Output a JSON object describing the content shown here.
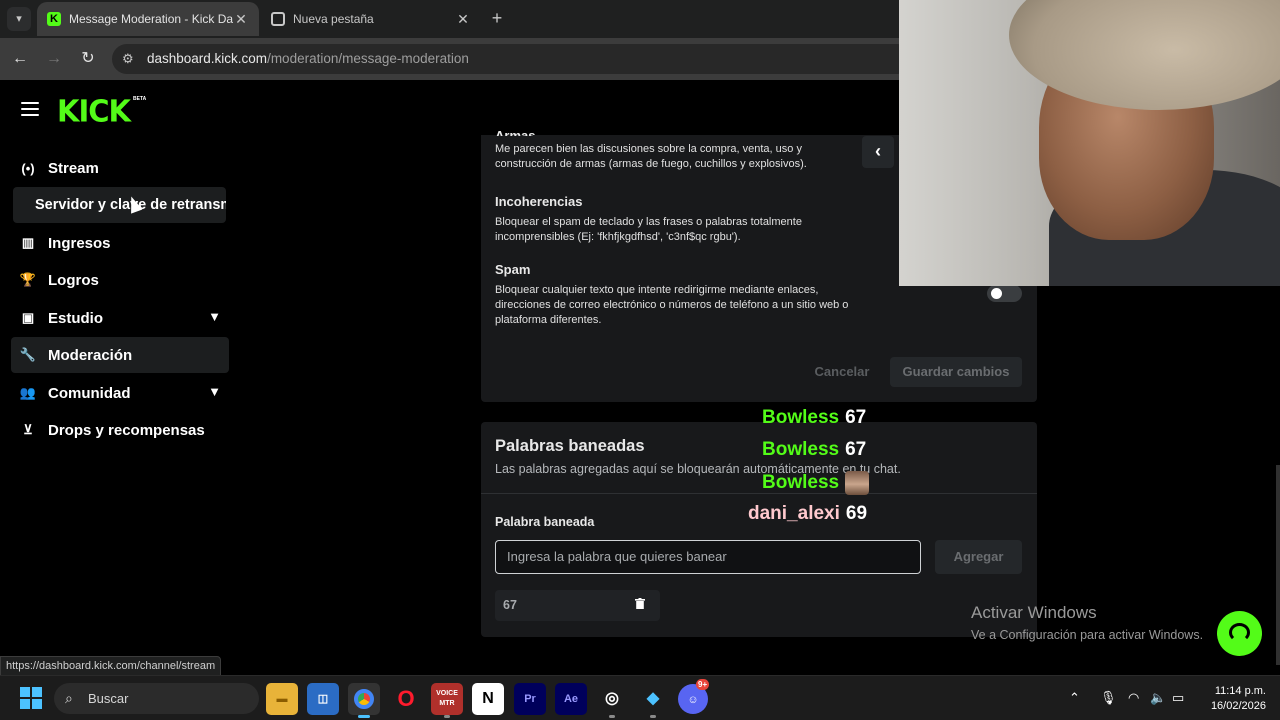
{
  "browser": {
    "tabs": [
      {
        "title": "Message Moderation - Kick Dashboard",
        "active": true
      },
      {
        "title": "Nueva pestaña",
        "active": false
      }
    ],
    "url_host": "dashboard.kick.com",
    "url_path": "/moderation/message-moderation"
  },
  "sidebar": {
    "logo": "KICK",
    "logo_badge": "BETA",
    "items": [
      {
        "label": "Stream",
        "icon": "broadcast-icon"
      },
      {
        "label": "Servidor y clave de retransmisión",
        "icon": ""
      },
      {
        "label": "Ingresos",
        "icon": "chart-icon"
      },
      {
        "label": "Logros",
        "icon": "trophy-icon"
      },
      {
        "label": "Estudio",
        "icon": "studio-icon",
        "expandable": true
      },
      {
        "label": "Moderación",
        "icon": "wrench-icon",
        "active": true
      },
      {
        "label": "Comunidad",
        "icon": "people-icon",
        "expandable": true
      },
      {
        "label": "Drops y recompensas",
        "icon": "drops-icon"
      }
    ]
  },
  "filters": {
    "partial_title": "Armas",
    "armas_desc": "Me parecen bien las discusiones sobre la compra, venta, uso y construcción de armas (armas de fuego, cuchillos y explosivos).",
    "incoherencias_title": "Incoherencias",
    "incoherencias_desc": "Bloquear el spam de teclado y las frases o palabras totalmente incomprensibles (Ej: 'fkhfjkgdfhsd', 'c3nf$qc rgbu').",
    "spam_title": "Spam",
    "spam_desc": "Bloquear cualquier texto que intente redirigirme mediante enlaces, direcciones de correo electrónico o números de teléfono a un sitio web o plataforma diferentes.",
    "spam_enabled": false,
    "cancel_label": "Cancelar",
    "save_label": "Guardar cambios"
  },
  "banned_words": {
    "title": "Palabras baneadas",
    "subtitle": "Las palabras agregadas aquí se bloquearán automáticamente en tu chat.",
    "field_label": "Palabra baneada",
    "placeholder": "Ingresa la palabra que quieres banear",
    "add_label": "Agregar",
    "words": [
      "67"
    ]
  },
  "chat_overlay": [
    {
      "user": "Bowless",
      "message": "67",
      "color": "#53fc18"
    },
    {
      "user": "Bowless",
      "message": "67",
      "color": "#53fc18"
    },
    {
      "user": "Bowless",
      "message": "",
      "emote": true,
      "color": "#53fc18"
    },
    {
      "user": "dani_alexi",
      "message": "69",
      "color": "#ffc9ce"
    }
  ],
  "windows_watermark": {
    "title": "Activar Windows",
    "subtitle": "Ve a Configuración para activar Windows."
  },
  "status_url": "https://dashboard.kick.com/channel/stream",
  "taskbar": {
    "search_placeholder": "Buscar",
    "time": "11:14 p.m.",
    "date": "16/02/2026",
    "discord_badge": "9+"
  },
  "colors": {
    "brand": "#53fc18",
    "accent": "#4cc2ff"
  }
}
